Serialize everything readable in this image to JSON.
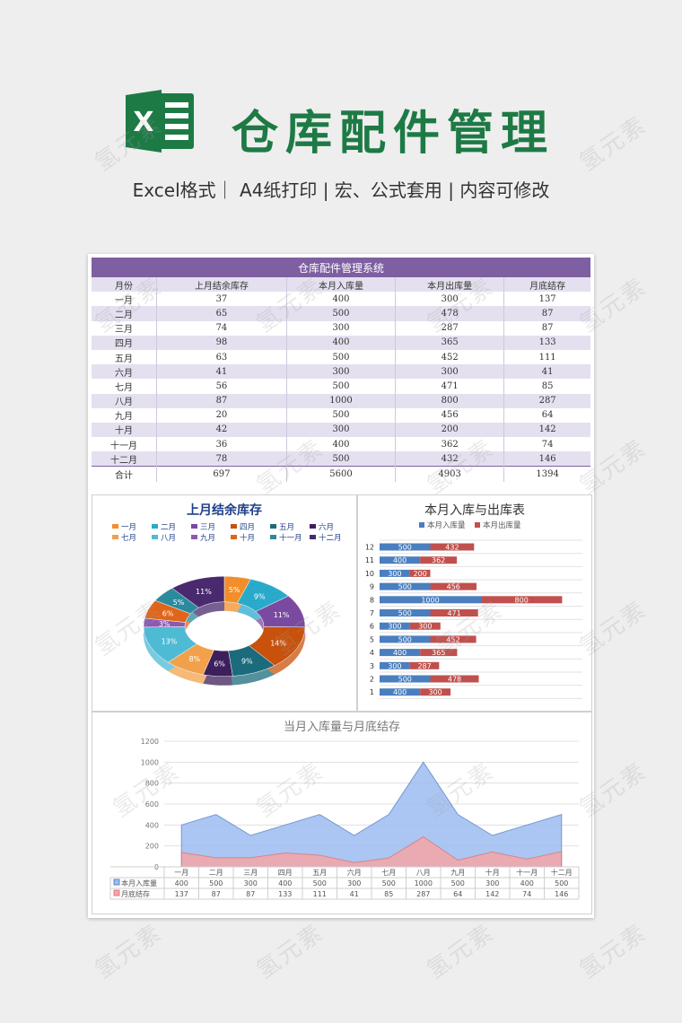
{
  "header": {
    "logo_letter": "X",
    "title": "仓库配件管理",
    "subtitle": "Excel格式｜ A4纸打印 | 宏、公式套用 | 内容可修改"
  },
  "table": {
    "title": "仓库配件管理系统",
    "columns": [
      "月份",
      "上月结余库存",
      "本月入库量",
      "本月出库量",
      "月底结存"
    ],
    "rows": [
      [
        "一月",
        "37",
        "400",
        "300",
        "137"
      ],
      [
        "二月",
        "65",
        "500",
        "478",
        "87"
      ],
      [
        "三月",
        "74",
        "300",
        "287",
        "87"
      ],
      [
        "四月",
        "98",
        "400",
        "365",
        "133"
      ],
      [
        "五月",
        "63",
        "500",
        "452",
        "111"
      ],
      [
        "六月",
        "41",
        "300",
        "300",
        "41"
      ],
      [
        "七月",
        "56",
        "500",
        "471",
        "85"
      ],
      [
        "八月",
        "87",
        "1000",
        "800",
        "287"
      ],
      [
        "九月",
        "20",
        "500",
        "456",
        "64"
      ],
      [
        "十月",
        "42",
        "300",
        "200",
        "142"
      ],
      [
        "十一月",
        "36",
        "400",
        "362",
        "74"
      ],
      [
        "十二月",
        "78",
        "500",
        "432",
        "146"
      ]
    ],
    "total": [
      "合计",
      "697",
      "5600",
      "4903",
      "1394"
    ]
  },
  "chart_data": [
    {
      "type": "pie",
      "title": "上月结余库存",
      "categories": [
        "一月",
        "二月",
        "三月",
        "四月",
        "五月",
        "六月",
        "七月",
        "八月",
        "九月",
        "十月",
        "十一月",
        "十二月"
      ],
      "values": [
        37,
        65,
        74,
        98,
        63,
        41,
        56,
        87,
        20,
        42,
        36,
        78
      ],
      "data_labels": [
        "5%",
        "9%",
        "11%",
        "14%",
        "9%",
        "6%",
        "8%",
        "13%",
        "3%",
        "6%",
        "5%",
        "11%"
      ],
      "colors": [
        "#f28e2b",
        "#2aaacb",
        "#7a4aa0",
        "#c8510b",
        "#1b6b7d",
        "#3d1f5c",
        "#f2a14b",
        "#4fbad4",
        "#8c5ab0",
        "#e0651a",
        "#2b8a9e",
        "#4a2a6e"
      ],
      "legend_position": "top"
    },
    {
      "type": "bar",
      "orientation": "horizontal",
      "title": "本月入库与出库表",
      "categories": [
        "1",
        "2",
        "3",
        "4",
        "5",
        "6",
        "7",
        "8",
        "9",
        "10",
        "11",
        "12"
      ],
      "series": [
        {
          "name": "本月入库量",
          "values": [
            400,
            500,
            300,
            400,
            500,
            300,
            500,
            1000,
            500,
            300,
            400,
            500
          ],
          "color": "#4a7ebf"
        },
        {
          "name": "本月出库量",
          "values": [
            300,
            478,
            287,
            365,
            452,
            300,
            471,
            800,
            456,
            200,
            362,
            432
          ],
          "color": "#c0504d"
        }
      ],
      "stacked": true,
      "legend_position": "top"
    },
    {
      "type": "area",
      "title": "当月入库量与月底结存",
      "categories": [
        "一月",
        "二月",
        "三月",
        "四月",
        "五月",
        "六月",
        "七月",
        "八月",
        "九月",
        "十月",
        "十一月",
        "十二月"
      ],
      "series": [
        {
          "name": "本月入库量",
          "values": [
            400,
            500,
            300,
            400,
            500,
            300,
            500,
            1000,
            500,
            300,
            400,
            500
          ],
          "color": "#9dbdf2"
        },
        {
          "name": "月底结存",
          "values": [
            137,
            87,
            87,
            133,
            111,
            41,
            85,
            287,
            64,
            142,
            74,
            146
          ],
          "color": "#f4a6a6"
        }
      ],
      "yticks": [
        "0",
        "200",
        "400",
        "600",
        "800",
        "1000",
        "1200"
      ],
      "ylim": [
        0,
        1200
      ],
      "grid": true,
      "data_table": true
    }
  ],
  "watermark": "氢元素"
}
